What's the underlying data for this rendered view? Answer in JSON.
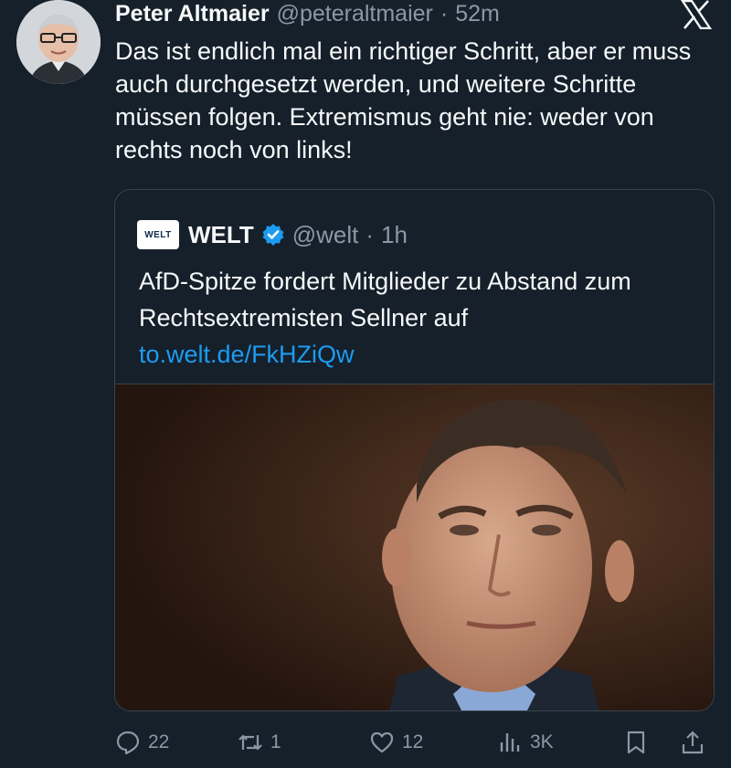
{
  "post": {
    "author_name": "Peter Altmaier",
    "author_handle": "@peteraltmaier",
    "separator": "·",
    "time": "52m",
    "text": "Das ist endlich mal ein richtiger Schritt, aber er muss auch durchgesetzt werden, und weitere Schritte müssen folgen. Extremismus geht nie: weder von rechts noch von links!"
  },
  "quote": {
    "logo_text": "WELT",
    "name": "WELT",
    "handle": "@welt",
    "separator": "·",
    "time": "1h",
    "text": "AfD-Spitze fordert Mitglieder zu Abstand zum Rechtsextremisten Sellner auf",
    "link": "to.welt.de/FkHZiQw"
  },
  "actions": {
    "replies": "22",
    "reposts": "1",
    "likes": "12",
    "views": "3K"
  },
  "icons": {
    "app": "x-logo-icon",
    "verified": "verified-badge-icon",
    "reply": "reply-icon",
    "repost": "repost-icon",
    "like": "heart-icon",
    "views": "views-icon",
    "bookmark": "bookmark-icon",
    "share": "share-icon"
  },
  "colors": {
    "background": "#15202b",
    "text": "#f7f9f9",
    "muted": "#8b98a5",
    "link": "#1d9bf0",
    "border": "#38444d"
  }
}
